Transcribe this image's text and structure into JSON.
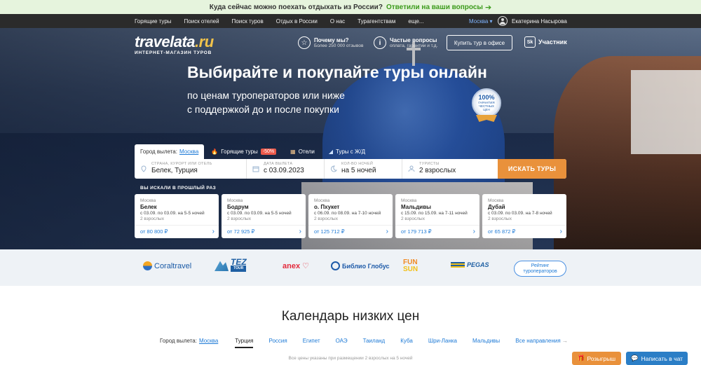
{
  "banner": {
    "text": "Куда сейчас можно поехать отдыхать из России?",
    "link": "Ответили на ваши вопросы"
  },
  "nav": {
    "items": [
      "Горящие туры",
      "Поиск отелей",
      "Поиск туров",
      "Отдых в России",
      "О нас",
      "Турагентствам",
      "еще..."
    ],
    "city": "Москва ▾",
    "user": "Екатерина Насырова"
  },
  "hero": {
    "logo": {
      "main": "travelata",
      "ru": ".ru",
      "tagline": "ИНТЕРНЕТ-МАГАЗИН ТУРОВ"
    },
    "why": {
      "title": "Почему мы?",
      "sub": "Более 250 000 отзывов"
    },
    "faq": {
      "title": "Частые вопросы",
      "sub": "оплата, гарантии и т.д."
    },
    "office_btn": "Купить тур в офисе",
    "sk": {
      "box": "Sk",
      "label": "Участник"
    },
    "headline": "Выбирайте и покупайте туры онлайн",
    "subline1": "по ценам туроператоров или ниже",
    "subline2": "с поддержкой до и после покупки",
    "badge": {
      "pct": "100%",
      "line1": "ГАРАНТИЯ",
      "line2": "ЧЕСТНЫХ",
      "line3": "ЦЕН"
    }
  },
  "search": {
    "tab_from_label": "Город вылета:",
    "tab_from_city": "Москва",
    "tab_hot": "Горящие туры",
    "tab_hot_badge": "-50%",
    "tab_hotels": "Отели",
    "tab_rail": "Туры с Ж/Д",
    "fields": [
      {
        "label": "СТРАНА, КУРОРТ ИЛИ ОТЕЛЬ",
        "value": "Белек, Турция"
      },
      {
        "label": "ДАТА ВЫЛЕТА",
        "value": "с 03.09.2023"
      },
      {
        "label": "КОЛ-ВО НОЧЕЙ",
        "value": "на 5 ночей"
      },
      {
        "label": "ТУРИСТЫ",
        "value": "2 взрослых"
      }
    ],
    "button": "ИСКАТЬ ТУРЫ"
  },
  "recent": {
    "title": "ВЫ ИСКАЛИ В ПРОШЛЫЙ РАЗ",
    "cards": [
      {
        "city": "Москва",
        "dest": "Белек",
        "dates": "с 03.09. по 03.09. на 5-5 ночей",
        "pax": "2 взрослых",
        "price": "от 80 800 ₽"
      },
      {
        "city": "Москва",
        "dest": "Бодрум",
        "dates": "с 03.09. по 03.09. на 5-5 ночей",
        "pax": "2 взрослых",
        "price": "от 72 925 ₽"
      },
      {
        "city": "Москва",
        "dest": "о. Пхукет",
        "dates": "с 06.09. по 08.09. на 7-10 ночей",
        "pax": "2 взрослых",
        "price": "от 125 712 ₽"
      },
      {
        "city": "Москва",
        "dest": "Мальдивы",
        "dates": "с 15.09. по 15.09. на 7-11 ночей",
        "pax": "2 взрослых",
        "price": "от 179 713 ₽"
      },
      {
        "city": "Москва",
        "dest": "Дубай",
        "dates": "с 03.09. по 03.09. на 7-8 ночей",
        "pax": "2 взрослых",
        "price": "от 65 872 ₽"
      }
    ]
  },
  "operators": {
    "coral": "Coraltravel",
    "tez": "TEZ",
    "tez_sub": "TOUR",
    "anex": "anex",
    "biblio": "Библио Глобус",
    "funsun_1": "FUN",
    "funsun_2": "SUN",
    "pegas": "PEGAS",
    "rating": "Рейтинг туроператоров"
  },
  "calendar": {
    "title": "Календарь низких цен",
    "from_label": "Город вылета:",
    "from_city": "Москва",
    "tabs": [
      "Турция",
      "Россия",
      "Египет",
      "ОАЭ",
      "Таиланд",
      "Куба",
      "Шри-Ланка",
      "Мальдивы",
      "Все направления"
    ],
    "note": "Все цены указаны при размещении 2 взрослых на 5 ночей"
  },
  "floating": {
    "promo": "Розыгрыш",
    "chat": "Написать в чат"
  },
  "colors": {
    "accent": "#e9913b",
    "link": "#1e7ad6",
    "banner_link": "#3a9a1a",
    "sale": "#ec5a4b"
  }
}
